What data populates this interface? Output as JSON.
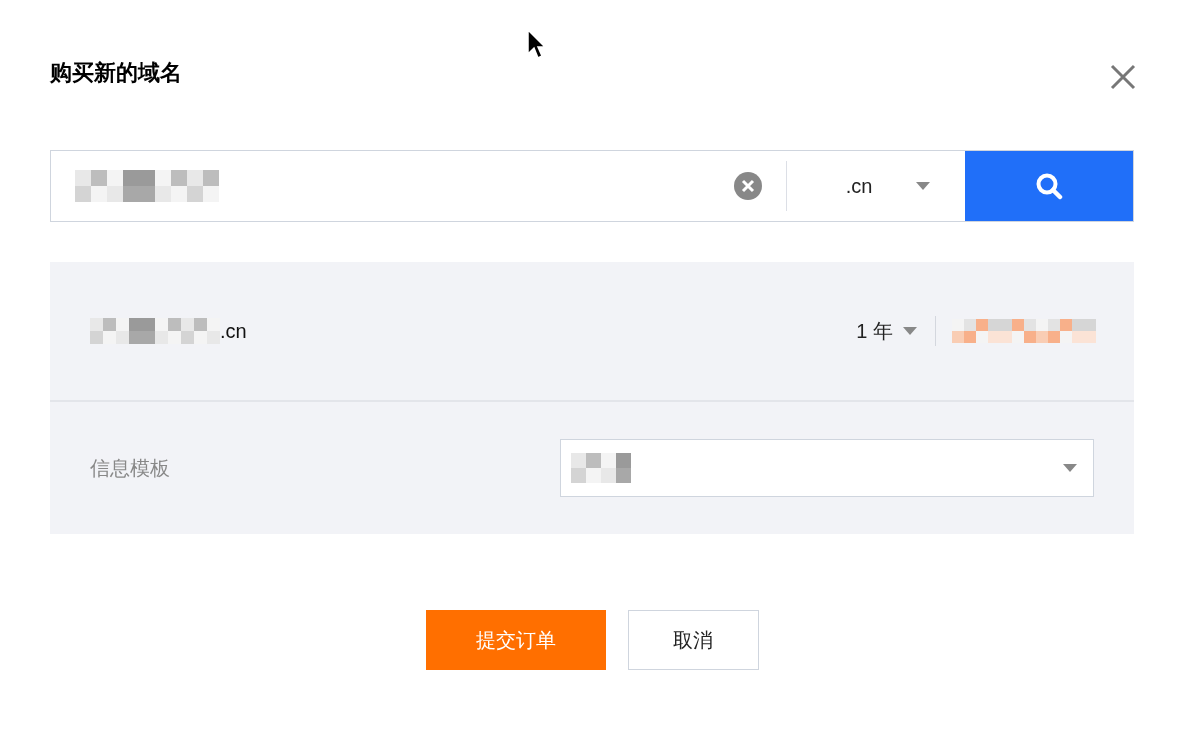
{
  "dialog": {
    "title": "购买新的域名"
  },
  "search": {
    "suffix": ".cn"
  },
  "result": {
    "domain_suffix": ".cn",
    "period": "1 年"
  },
  "template": {
    "label": "信息模板"
  },
  "buttons": [
    {
      "label": "提交订单",
      "kind": "primary"
    },
    {
      "label": "取消",
      "kind": "secondary"
    }
  ]
}
